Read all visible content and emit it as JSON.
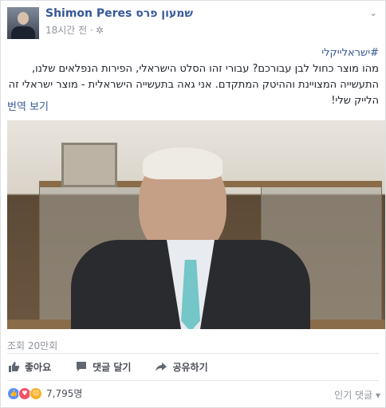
{
  "post": {
    "author": "Shimon Peres שמעון פרס",
    "time": "18시간 전 · ",
    "hashtag": "#ישראלייקלי",
    "body": "מהו מוצר כחול לבן עבורכם? עבורי זהו הסלט הישראלי, הפירות הנפלאים שלנו, התעשייה המצויינת וההיטק המתקדם. אני גאה בתעשייה הישראלית - מוצר ישראלי זה הלייק שלי!",
    "translate": "번역 보기",
    "views": "조회 20만회"
  },
  "actions": {
    "like": "좋아요",
    "comment": "댓글 달기",
    "share": "공유하기"
  },
  "reactions": {
    "count": "7,795명",
    "sort": "인기 댓글"
  },
  "icons": {
    "privacy": "gear-icon",
    "options": "chevron-down-icon"
  },
  "colors": {
    "link": "#365899",
    "like": "#5890ff",
    "love": "#f25268",
    "sad": "#f7b125"
  }
}
